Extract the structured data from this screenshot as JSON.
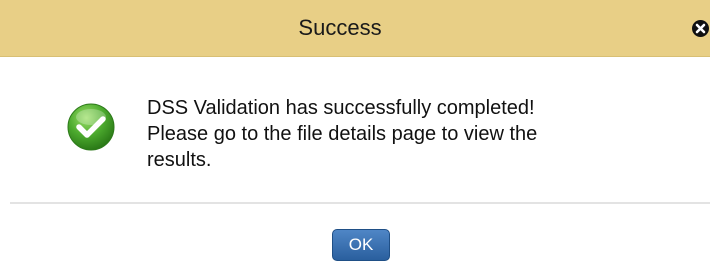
{
  "dialog": {
    "title": "Success",
    "close_icon": "close-icon",
    "status_icon": "success-check-icon",
    "message_lines": [
      "DSS Validation has successfully completed!",
      "Please go to the file details page to view the",
      "results."
    ],
    "ok_label": "OK"
  },
  "colors": {
    "titlebar": "#e8cf86",
    "ok_button": "#2f6aa8",
    "success_icon": "#4caa2e"
  }
}
